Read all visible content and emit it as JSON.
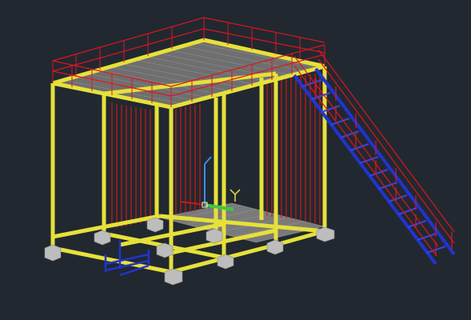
{
  "viewport": {
    "background": "#212830"
  },
  "model": {
    "frame_color": "#e6e13a",
    "railing_color": "#e0141e",
    "panel_color": "#c81a1a",
    "grating_color": "#8c8c8c",
    "stair_color": "#2233d0",
    "base_color": "#bdbdbd"
  },
  "ucs": {
    "x_axis_color": "#3ec83e",
    "y_axis_color": "#3a8ef0",
    "z_axis_color": "#e6e13a",
    "origin_color": "#ffffff",
    "y_label": "Y"
  }
}
